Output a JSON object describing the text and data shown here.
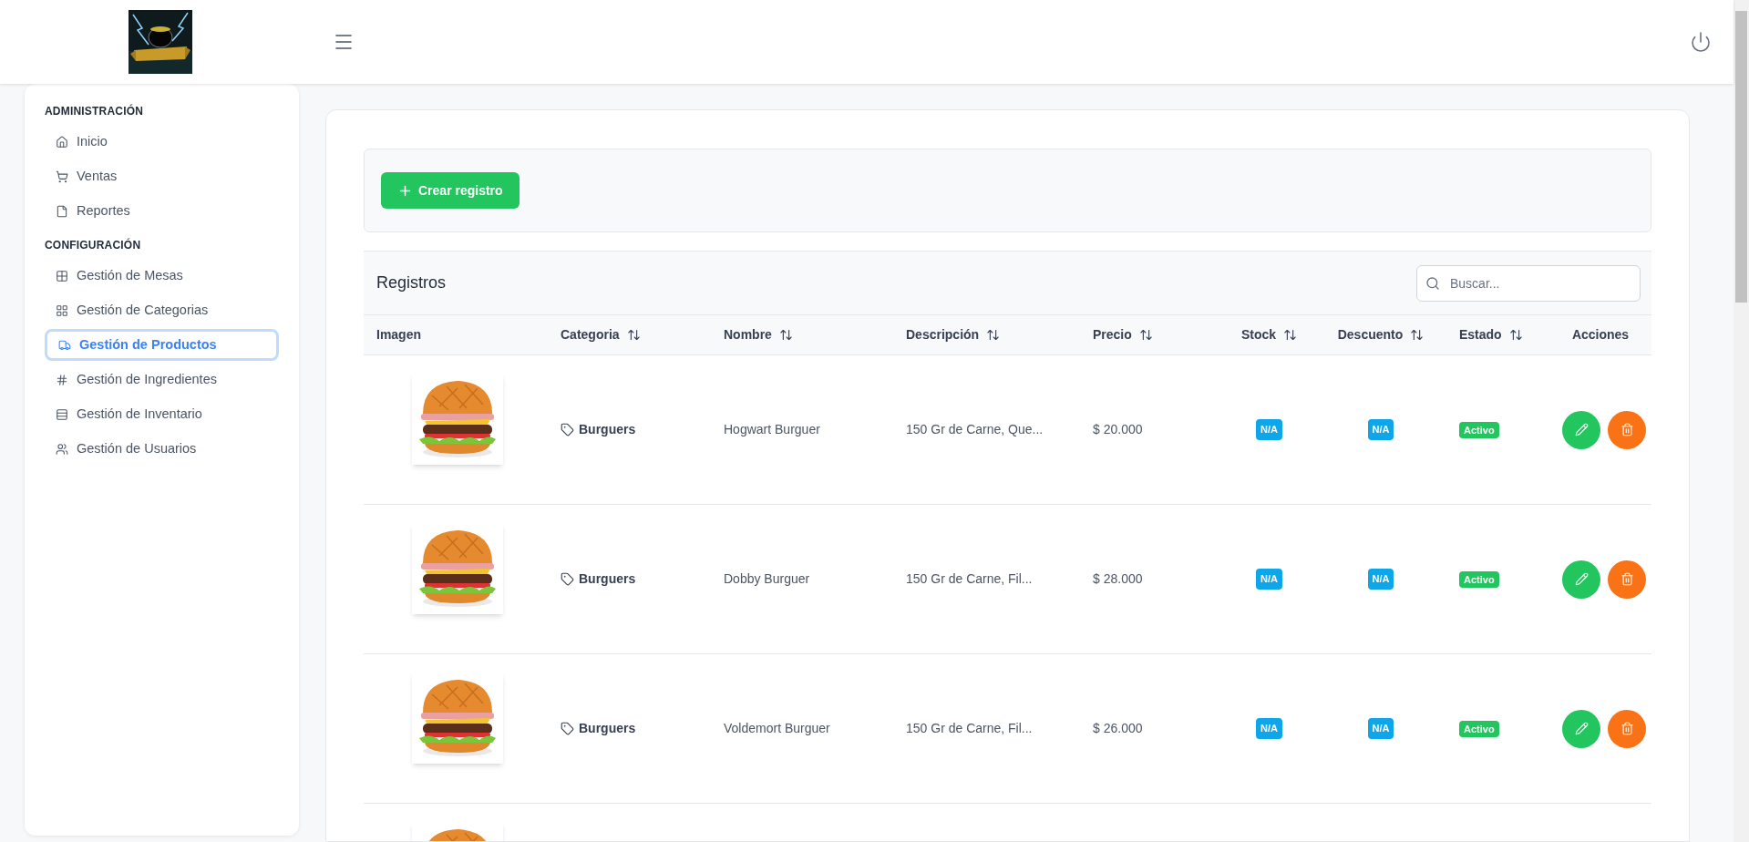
{
  "header": {
    "logo": {
      "kind": "picture"
    }
  },
  "sidebar": {
    "sections": [
      {
        "title": "ADMINISTRACIÓN",
        "items": [
          {
            "label": "Inicio",
            "selected": false
          },
          {
            "label": "Ventas",
            "selected": false
          },
          {
            "label": "Reportes",
            "selected": false
          }
        ]
      },
      {
        "title": "CONFIGURACIÓN",
        "items": [
          {
            "label": "Gestión de Mesas",
            "selected": false
          },
          {
            "label": "Gestión de Categorias",
            "selected": false
          },
          {
            "label": "Gestión de Productos",
            "selected": true
          },
          {
            "label": "Gestión de Ingredientes",
            "selected": false
          },
          {
            "label": "Gestión de Inventario",
            "selected": false
          },
          {
            "label": "Gestión de Usuarios",
            "selected": false
          }
        ]
      }
    ]
  },
  "toolbar": {
    "create_button": "Crear registro"
  },
  "table": {
    "title": "Registros",
    "search": {
      "placeholder": "Buscar..."
    },
    "columns": [
      {
        "label": "Imagen",
        "sortable": false
      },
      {
        "label": "Categoria",
        "sortable": true
      },
      {
        "label": "Nombre",
        "sortable": true
      },
      {
        "label": "Descripción",
        "sortable": true
      },
      {
        "label": "Precio",
        "sortable": true
      },
      {
        "label": "Stock",
        "sortable": true
      },
      {
        "label": "Descuento",
        "sortable": true
      },
      {
        "label": "Estado",
        "sortable": true
      },
      {
        "label": "Acciones",
        "sortable": false
      }
    ],
    "rows": [
      {
        "image": {
          "kind": "picture"
        },
        "category": "Burguers",
        "name": "Hogwart Burguer",
        "description": "150 Gr de Carne, Que...",
        "price": "$ 20.000",
        "stock": "N/A",
        "discount": "N/A",
        "status": "Activo"
      },
      {
        "image": {
          "kind": "picture"
        },
        "category": "Burguers",
        "name": "Dobby Burguer",
        "description": "150 Gr de Carne, Fil...",
        "price": "$ 28.000",
        "stock": "N/A",
        "discount": "N/A",
        "status": "Activo"
      },
      {
        "image": {
          "kind": "picture"
        },
        "category": "Burguers",
        "name": "Voldemort Burguer",
        "description": "150 Gr de Carne, Fil...",
        "price": "$ 26.000",
        "stock": "N/A",
        "discount": "N/A",
        "status": "Activo"
      },
      {
        "image": {
          "kind": "picture"
        }
      }
    ]
  }
}
